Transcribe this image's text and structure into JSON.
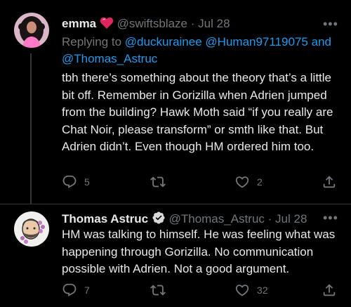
{
  "tweets": [
    {
      "author_name": "emma",
      "handle": "@swiftsblaze",
      "separator": "·",
      "date": "Jul 28",
      "replying_prefix": "Replying to",
      "replying_mention1": "@duckurainee",
      "replying_mention2": "@Human97119075",
      "replying_and": "and",
      "replying_mention3": "@Thomas_Astruc",
      "text": "tbh there’s something about the theory that’s a little bit off. Remember in Gorizilla when Adrien jumped from the building? Hawk Moth said “if you really are Chat Noir, please transform” or smth like that. But Adrien didn’t. Even though HM ordered him too.",
      "reply_count": "5",
      "retweet_count": "",
      "like_count": "2",
      "name_badge_icon": "heart-emoji-icon",
      "avatar": "avatar-emma"
    },
    {
      "author_name": "Thomas Astruc",
      "handle": "@Thomas_Astruc",
      "separator": "·",
      "date": "Jul 28",
      "text": "HM was talking to himself. He was feeling what was happening through Gorizilla. No communication possible with Adrien. Not a good argument.",
      "reply_count": "7",
      "retweet_count": "",
      "like_count": "32",
      "name_badge_icon": "verified-badge-icon",
      "avatar": "avatar-thomas-astruc"
    }
  ],
  "more_label": "•••",
  "colors": {
    "background": "#000000",
    "text": "#e7e9ea",
    "muted": "#71767b",
    "link": "#1d9bf0",
    "heart": "#e0245e"
  }
}
